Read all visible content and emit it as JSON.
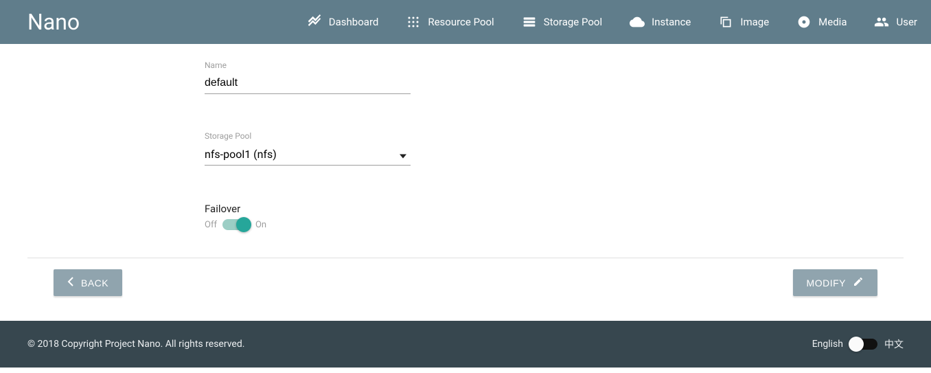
{
  "header": {
    "brand": "Nano",
    "nav": [
      {
        "label": "Dashboard"
      },
      {
        "label": "Resource Pool"
      },
      {
        "label": "Storage Pool"
      },
      {
        "label": "Instance"
      },
      {
        "label": "Image"
      },
      {
        "label": "Media"
      },
      {
        "label": "User"
      }
    ]
  },
  "form": {
    "name_label": "Name",
    "name_value": "default",
    "storage_label": "Storage Pool",
    "storage_selected": "nfs-pool1 (nfs)",
    "storage_options": [
      "nfs-pool1 (nfs)"
    ],
    "failover_label": "Failover",
    "failover_off": "Off",
    "failover_on": "On",
    "failover_state": true
  },
  "actions": {
    "back": "BACK",
    "modify": "MODIFY"
  },
  "footer": {
    "copyright": "© 2018 Copyright Project Nano. All rights reserved.",
    "lang_en": "English",
    "lang_zh": "中文"
  }
}
